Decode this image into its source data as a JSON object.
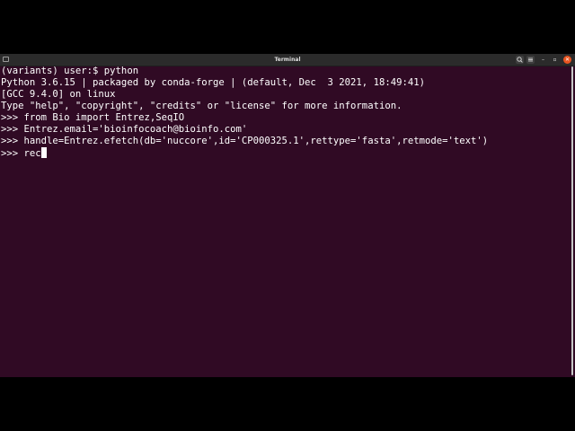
{
  "window": {
    "title": "Terminal"
  },
  "titlebar_icons": {
    "left": "terminal-icon",
    "search": "search-icon",
    "menu": "hamburger-menu-icon",
    "minimize": "–",
    "maximize": "▫",
    "close": "✕"
  },
  "terminal": {
    "lines": [
      "(variants) user:$ python",
      "Python 3.6.15 | packaged by conda-forge | (default, Dec  3 2021, 18:49:41)",
      "[GCC 9.4.0] on linux",
      "Type \"help\", \"copyright\", \"credits\" or \"license\" for more information.",
      ">>> from Bio import Entrez,SeqIO",
      ">>> Entrez.email='bioinfocoach@bioinfo.com'",
      ">>> handle=Entrez.efetch(db='nuccore',id='CP000325.1',rettype='fasta',retmode='text')",
      ">>> rec"
    ]
  },
  "colors": {
    "terminal_bg": "#300a24",
    "titlebar_bg": "#2b2b2b",
    "close_button": "#e95420",
    "text": "#ffffff"
  }
}
